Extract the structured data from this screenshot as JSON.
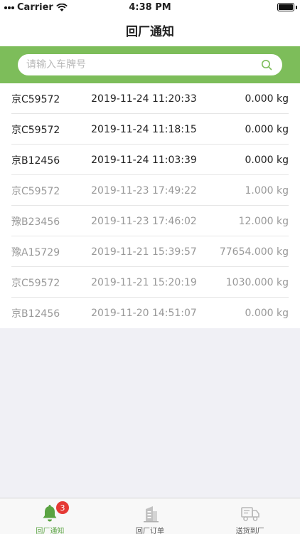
{
  "status_bar": {
    "carrier": "Carrier",
    "time": "4:38 PM"
  },
  "nav": {
    "title": "回厂通知"
  },
  "search": {
    "placeholder": "请输入车牌号"
  },
  "rows": [
    {
      "plate": "京C59572",
      "time": "2019-11-24 11:20:33",
      "weight": "0.000 kg",
      "dim": false
    },
    {
      "plate": "京C59572",
      "time": "2019-11-24 11:18:15",
      "weight": "0.000 kg",
      "dim": false
    },
    {
      "plate": "京B12456",
      "time": "2019-11-24 11:03:39",
      "weight": "0.000 kg",
      "dim": false
    },
    {
      "plate": "京C59572",
      "time": "2019-11-23 17:49:22",
      "weight": "1.000 kg",
      "dim": true
    },
    {
      "plate": "豫B23456",
      "time": "2019-11-23 17:46:02",
      "weight": "12.000 kg",
      "dim": true
    },
    {
      "plate": "豫A15729",
      "time": "2019-11-21 15:39:57",
      "weight": "77654.000 kg",
      "dim": true
    },
    {
      "plate": "京C59572",
      "time": "2019-11-21 15:20:19",
      "weight": "1030.000 kg",
      "dim": true
    },
    {
      "plate": "京B12456",
      "time": "2019-11-20 14:51:07",
      "weight": "0.000 kg",
      "dim": true
    }
  ],
  "tabs": {
    "notice": {
      "label": "回厂通知",
      "badge": "3",
      "icon": "bell-icon"
    },
    "orders": {
      "label": "回厂订单",
      "icon": "building-icon"
    },
    "delivery": {
      "label": "送货到厂",
      "icon": "truck-icon"
    }
  },
  "colors": {
    "accent": "#7dbd5a",
    "active_tab": "#5aa342",
    "badge": "#e53935"
  }
}
